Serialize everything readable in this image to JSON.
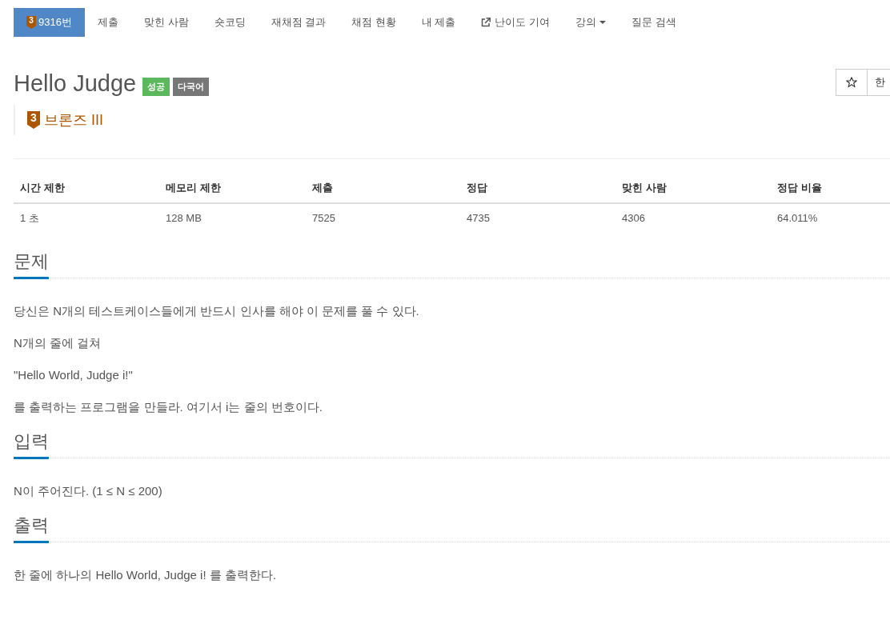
{
  "nav": {
    "tabs": [
      {
        "label": "9316번",
        "selected": true,
        "kind": "problem",
        "tier_number": "3"
      },
      {
        "label": "제출",
        "selected": false,
        "kind": "plain"
      },
      {
        "label": "맞힌 사람",
        "selected": false,
        "kind": "plain"
      },
      {
        "label": "숏코딩",
        "selected": false,
        "kind": "plain"
      },
      {
        "label": "재채점 결과",
        "selected": false,
        "kind": "plain"
      },
      {
        "label": "채점 현황",
        "selected": false,
        "kind": "plain"
      },
      {
        "label": "내 제출",
        "selected": false,
        "kind": "plain"
      },
      {
        "label": "난이도 기여",
        "selected": false,
        "kind": "external"
      },
      {
        "label": "강의",
        "selected": false,
        "kind": "dropdown"
      },
      {
        "label": "질문 검색",
        "selected": false,
        "kind": "plain"
      }
    ]
  },
  "problem": {
    "title": "Hello Judge",
    "labels": [
      {
        "text": "성공",
        "color": "#5cb85c"
      },
      {
        "text": "다국어",
        "color": "#777777"
      }
    ],
    "starred": false,
    "language": "한",
    "tier": {
      "number": "3",
      "name": "브론즈 III"
    }
  },
  "table": {
    "columns": [
      "시간 제한",
      "메모리 제한",
      "제출",
      "정답",
      "맞힌 사람",
      "정답 비율"
    ],
    "rows": [
      [
        "1 초",
        "128 MB",
        "7525",
        "4735",
        "4306",
        "64.011%"
      ]
    ]
  },
  "sections": [
    {
      "heading": "문제",
      "paragraphs": [
        "당신은 N개의 테스트케이스들에게 반드시 인사를 해야 이 문제를 풀 수 있다.",
        "N개의 줄에 걸쳐",
        "\"Hello World, Judge i!\"",
        "를 출력하는 프로그램을 만들라. 여기서 i는 줄의 번호이다."
      ]
    },
    {
      "heading": "입력",
      "paragraphs": [
        "N이 주어진다. (1 ≤ N ≤ 200)"
      ]
    },
    {
      "heading": "출력",
      "paragraphs": [
        "한 줄에 하나의 Hello World, Judge i! 를 출력한다."
      ]
    }
  ]
}
